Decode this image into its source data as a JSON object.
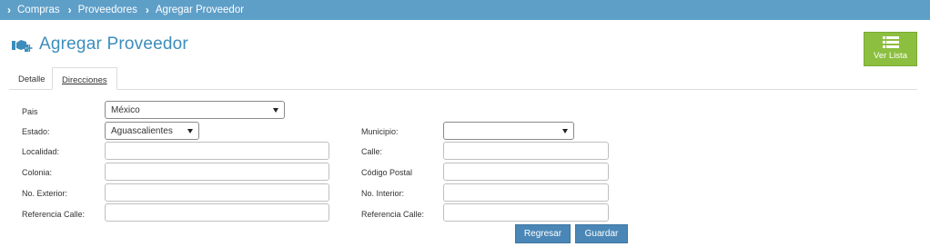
{
  "breadcrumb": {
    "items": [
      "Compras",
      "Proveedores",
      "Agregar Proveedor"
    ]
  },
  "title": "Agregar Proveedor",
  "list_button": "Ver Lista",
  "tabs": [
    "Detalle",
    "Direcciones"
  ],
  "form": {
    "pais": {
      "label": "Pais",
      "value": "México"
    },
    "estado": {
      "label": "Estado:",
      "value": "Aguascalientes"
    },
    "municipio": {
      "label": "Municipio:",
      "value": ""
    },
    "localidad": {
      "label": "Localidad:",
      "value": ""
    },
    "calle": {
      "label": "Calle:",
      "value": ""
    },
    "colonia": {
      "label": "Colonia:",
      "value": ""
    },
    "codigo_postal": {
      "label": "Código Postal",
      "value": ""
    },
    "no_exterior": {
      "label": "No. Exterior:",
      "value": ""
    },
    "no_interior": {
      "label": "No. Interior:",
      "value": ""
    },
    "referencia_calle_1": {
      "label": "Referencia Calle:",
      "value": ""
    },
    "referencia_calle_2": {
      "label": "Referencia Calle:",
      "value": ""
    }
  },
  "buttons": {
    "regresar": "Regresar",
    "guardar": "Guardar"
  },
  "colors": {
    "header": "#5e9fc8",
    "title": "#3c8dbc",
    "list_button": "#8cbf3f",
    "action_button": "#4a87b6"
  }
}
